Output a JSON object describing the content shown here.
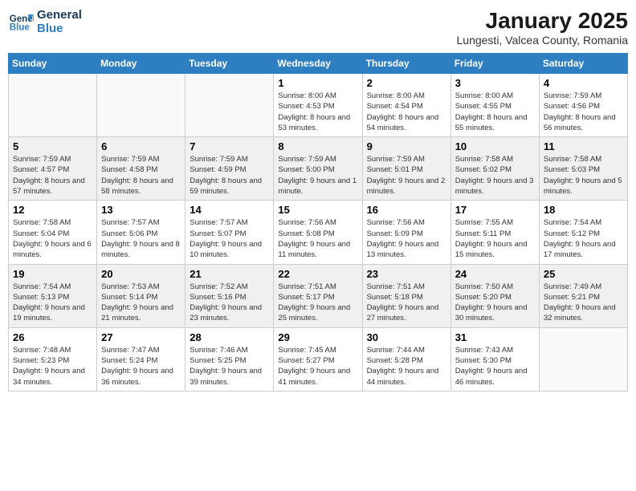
{
  "logo": {
    "line1": "General",
    "line2": "Blue"
  },
  "title": "January 2025",
  "subtitle": "Lungesti, Valcea County, Romania",
  "weekdays": [
    "Sunday",
    "Monday",
    "Tuesday",
    "Wednesday",
    "Thursday",
    "Friday",
    "Saturday"
  ],
  "weeks": [
    [
      {
        "day": "",
        "detail": ""
      },
      {
        "day": "",
        "detail": ""
      },
      {
        "day": "",
        "detail": ""
      },
      {
        "day": "1",
        "detail": "Sunrise: 8:00 AM\nSunset: 4:53 PM\nDaylight: 8 hours and 53 minutes."
      },
      {
        "day": "2",
        "detail": "Sunrise: 8:00 AM\nSunset: 4:54 PM\nDaylight: 8 hours and 54 minutes."
      },
      {
        "day": "3",
        "detail": "Sunrise: 8:00 AM\nSunset: 4:55 PM\nDaylight: 8 hours and 55 minutes."
      },
      {
        "day": "4",
        "detail": "Sunrise: 7:59 AM\nSunset: 4:56 PM\nDaylight: 8 hours and 56 minutes."
      }
    ],
    [
      {
        "day": "5",
        "detail": "Sunrise: 7:59 AM\nSunset: 4:57 PM\nDaylight: 8 hours and 57 minutes."
      },
      {
        "day": "6",
        "detail": "Sunrise: 7:59 AM\nSunset: 4:58 PM\nDaylight: 8 hours and 58 minutes."
      },
      {
        "day": "7",
        "detail": "Sunrise: 7:59 AM\nSunset: 4:59 PM\nDaylight: 8 hours and 59 minutes."
      },
      {
        "day": "8",
        "detail": "Sunrise: 7:59 AM\nSunset: 5:00 PM\nDaylight: 9 hours and 1 minute."
      },
      {
        "day": "9",
        "detail": "Sunrise: 7:59 AM\nSunset: 5:01 PM\nDaylight: 9 hours and 2 minutes."
      },
      {
        "day": "10",
        "detail": "Sunrise: 7:58 AM\nSunset: 5:02 PM\nDaylight: 9 hours and 3 minutes."
      },
      {
        "day": "11",
        "detail": "Sunrise: 7:58 AM\nSunset: 5:03 PM\nDaylight: 9 hours and 5 minutes."
      }
    ],
    [
      {
        "day": "12",
        "detail": "Sunrise: 7:58 AM\nSunset: 5:04 PM\nDaylight: 9 hours and 6 minutes."
      },
      {
        "day": "13",
        "detail": "Sunrise: 7:57 AM\nSunset: 5:06 PM\nDaylight: 9 hours and 8 minutes."
      },
      {
        "day": "14",
        "detail": "Sunrise: 7:57 AM\nSunset: 5:07 PM\nDaylight: 9 hours and 10 minutes."
      },
      {
        "day": "15",
        "detail": "Sunrise: 7:56 AM\nSunset: 5:08 PM\nDaylight: 9 hours and 11 minutes."
      },
      {
        "day": "16",
        "detail": "Sunrise: 7:56 AM\nSunset: 5:09 PM\nDaylight: 9 hours and 13 minutes."
      },
      {
        "day": "17",
        "detail": "Sunrise: 7:55 AM\nSunset: 5:11 PM\nDaylight: 9 hours and 15 minutes."
      },
      {
        "day": "18",
        "detail": "Sunrise: 7:54 AM\nSunset: 5:12 PM\nDaylight: 9 hours and 17 minutes."
      }
    ],
    [
      {
        "day": "19",
        "detail": "Sunrise: 7:54 AM\nSunset: 5:13 PM\nDaylight: 9 hours and 19 minutes."
      },
      {
        "day": "20",
        "detail": "Sunrise: 7:53 AM\nSunset: 5:14 PM\nDaylight: 9 hours and 21 minutes."
      },
      {
        "day": "21",
        "detail": "Sunrise: 7:52 AM\nSunset: 5:16 PM\nDaylight: 9 hours and 23 minutes."
      },
      {
        "day": "22",
        "detail": "Sunrise: 7:51 AM\nSunset: 5:17 PM\nDaylight: 9 hours and 25 minutes."
      },
      {
        "day": "23",
        "detail": "Sunrise: 7:51 AM\nSunset: 5:18 PM\nDaylight: 9 hours and 27 minutes."
      },
      {
        "day": "24",
        "detail": "Sunrise: 7:50 AM\nSunset: 5:20 PM\nDaylight: 9 hours and 30 minutes."
      },
      {
        "day": "25",
        "detail": "Sunrise: 7:49 AM\nSunset: 5:21 PM\nDaylight: 9 hours and 32 minutes."
      }
    ],
    [
      {
        "day": "26",
        "detail": "Sunrise: 7:48 AM\nSunset: 5:23 PM\nDaylight: 9 hours and 34 minutes."
      },
      {
        "day": "27",
        "detail": "Sunrise: 7:47 AM\nSunset: 5:24 PM\nDaylight: 9 hours and 36 minutes."
      },
      {
        "day": "28",
        "detail": "Sunrise: 7:46 AM\nSunset: 5:25 PM\nDaylight: 9 hours and 39 minutes."
      },
      {
        "day": "29",
        "detail": "Sunrise: 7:45 AM\nSunset: 5:27 PM\nDaylight: 9 hours and 41 minutes."
      },
      {
        "day": "30",
        "detail": "Sunrise: 7:44 AM\nSunset: 5:28 PM\nDaylight: 9 hours and 44 minutes."
      },
      {
        "day": "31",
        "detail": "Sunrise: 7:43 AM\nSunset: 5:30 PM\nDaylight: 9 hours and 46 minutes."
      },
      {
        "day": "",
        "detail": ""
      }
    ]
  ]
}
